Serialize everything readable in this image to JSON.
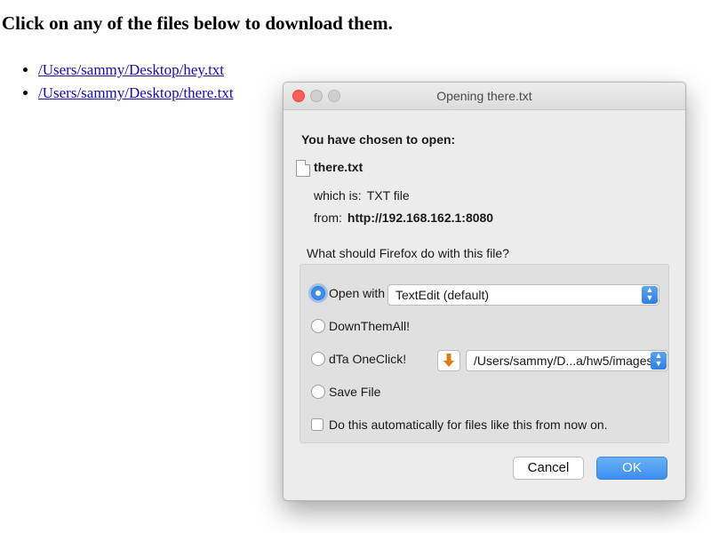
{
  "page": {
    "heading": "Click on any of the files below to download them.",
    "files": [
      "/Users/sammy/Desktop/hey.txt",
      "/Users/sammy/Desktop/there.txt"
    ]
  },
  "dialog": {
    "title": "Opening there.txt",
    "chosen_label": "You have chosen to open:",
    "file_name": "there.txt",
    "which_is_label": "which is:",
    "which_is_value": "TXT file",
    "from_label": "from:",
    "from_value": "http://192.168.162.1:8080",
    "question": "What should Firefox do with this file?",
    "options": {
      "open_with": {
        "label": "Open with",
        "selected_app": "TextEdit (default)",
        "checked": true
      },
      "downthemall": {
        "label": "DownThemAll!",
        "checked": false
      },
      "dta_oneclick": {
        "label": "dTa OneClick!",
        "path": "/Users/sammy/D...a/hw5/images/",
        "checked": false
      },
      "save_file": {
        "label": "Save File",
        "checked": false
      }
    },
    "auto_checkbox": {
      "label": "Do this automatically for files like this from now on.",
      "checked": false
    },
    "buttons": {
      "cancel": "Cancel",
      "ok": "OK"
    }
  },
  "colors": {
    "accent": "#3d8ee8",
    "close_button": "#fc5f57",
    "link": "#1a0dab",
    "arrow_icon": "#e07b1a"
  }
}
